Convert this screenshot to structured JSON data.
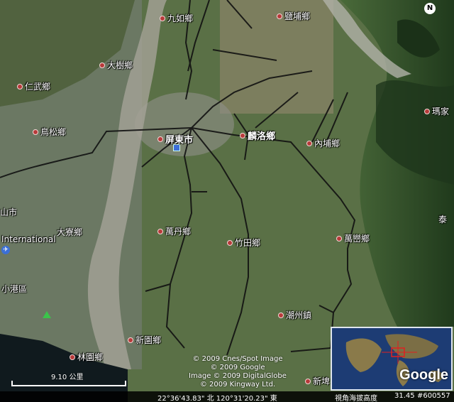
{
  "map": {
    "places": [
      {
        "id": "jiuru",
        "label": "九如鄉"
      },
      {
        "id": "yanpu",
        "label": "鹽埔鄉"
      },
      {
        "id": "dashu",
        "label": "大樹鄉"
      },
      {
        "id": "renwu",
        "label": "仁武鄉"
      },
      {
        "id": "niaosong",
        "label": "鳥松鄉"
      },
      {
        "id": "pingtung",
        "label": "屏東市"
      },
      {
        "id": "linluo",
        "label": "麟洛鄉"
      },
      {
        "id": "neipu",
        "label": "內埔鄉"
      },
      {
        "id": "majia",
        "label": "瑪家"
      },
      {
        "id": "shanshi",
        "label": "山市"
      },
      {
        "id": "international",
        "label": "International"
      },
      {
        "id": "daliao",
        "label": "大寮鄉"
      },
      {
        "id": "wandan",
        "label": "萬丹鄉"
      },
      {
        "id": "zhutian",
        "label": "竹田鄉"
      },
      {
        "id": "wanluan",
        "label": "萬巒鄉"
      },
      {
        "id": "xiaogang",
        "label": "小港區"
      },
      {
        "id": "chaozhou",
        "label": "潮州鎮"
      },
      {
        "id": "xinyuan",
        "label": "新園鄉"
      },
      {
        "id": "linyuan",
        "label": "林園鄉"
      },
      {
        "id": "xinpi",
        "label": "新埤"
      },
      {
        "id": "tai",
        "label": "泰"
      }
    ],
    "compass": "N",
    "credits": [
      "© 2009 Cnes/Spot Image",
      "© 2009 Google",
      "Image © 2009 DigitalGlobe",
      "© 2009 Kingway Ltd."
    ],
    "scale_label": "9.10 公里",
    "overview_logo": "Google",
    "status": {
      "coordinates": "22°36'43.83\" 北   120°31'20.23\" 東",
      "elevation": "視角海拔高度",
      "elevation_value": "31.45",
      "id_tag": "#600557"
    }
  }
}
